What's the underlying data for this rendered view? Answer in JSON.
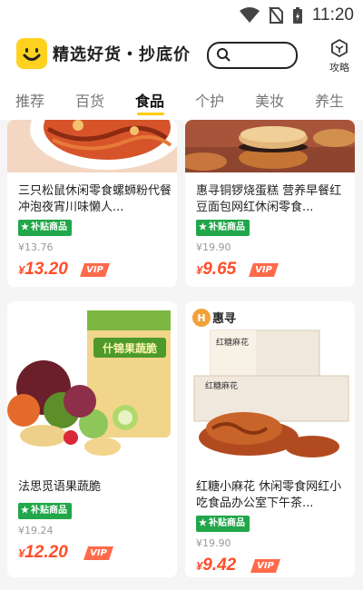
{
  "status": {
    "time": "11:20"
  },
  "header": {
    "title": "精选好货・抄底价",
    "guide_label": "攻略"
  },
  "tabs": [
    {
      "label": "推荐"
    },
    {
      "label": "百货"
    },
    {
      "label": "食品"
    },
    {
      "label": "个护"
    },
    {
      "label": "美妆"
    },
    {
      "label": "养生"
    }
  ],
  "active_tab": "食品",
  "products": [
    {
      "name": "三只松鼠休闲零食螺蛳粉代餐冲泡夜宵川味懒人...",
      "badge": "补贴商品",
      "original_price": "¥13.76",
      "price_symbol": "¥",
      "price": "13.20",
      "vip": "VIP"
    },
    {
      "name": "惠寻铜锣烧蛋糕 营养早餐红豆面包网红休闲零食...",
      "badge": "补贴商品",
      "original_price": "¥19.90",
      "price_symbol": "¥",
      "price": "9.65",
      "vip": "VIP"
    },
    {
      "name": "法思觅语果蔬脆",
      "badge": "补贴商品",
      "original_price": "¥19.24",
      "price_symbol": "¥",
      "price": "12.20",
      "vip": "VIP",
      "package_text": "什锦果蔬脆"
    },
    {
      "name": "红糖小麻花 休闲零食网红小吃食品办公室下午茶...",
      "badge": "补贴商品",
      "original_price": "¥19.90",
      "price_symbol": "¥",
      "price": "9.42",
      "vip": "VIP",
      "brand": "惠寻",
      "box_text": "红糖麻花"
    }
  ],
  "colors": {
    "accent": "#ffcc00",
    "price": "#ff4d28",
    "badge": "#21a74a"
  }
}
